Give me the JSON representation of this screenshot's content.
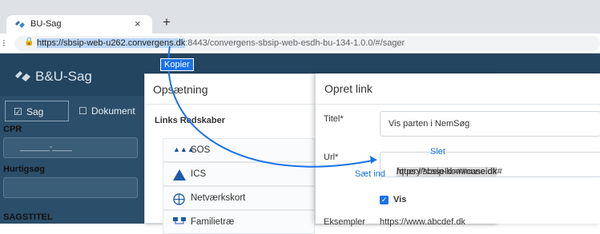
{
  "browser": {
    "tab_title": "BU-Sag",
    "tab_close": "×",
    "new_tab": "+",
    "url_selected": "https://sbsip-web-u262.convergens.dk",
    "url_rest": ":8443/convergens-sbsip-web-esdh-bu-134-1.0.0/#/sager"
  },
  "overlay": {
    "copy_label": "Kopier",
    "delete_label": "Slet",
    "insert_label": "Sæt ind",
    "accent": "#1a73e8"
  },
  "app": {
    "title": "B&U-Sag",
    "tabs": [
      {
        "label": "Sag"
      },
      {
        "label": "Dokument"
      }
    ],
    "fields": {
      "cpr_label": "CPR",
      "cpr_value": "______-____",
      "quick_label": "Hurtigsøg",
      "title_label": "SAGSTITEL"
    },
    "header_color": "#234560"
  },
  "setup_dialog": {
    "title": "Opsætning",
    "section": "Links Redskaber",
    "items": [
      {
        "label": "SOS",
        "icon": "sos-icon"
      },
      {
        "label": "ICS",
        "icon": "ics-icon"
      },
      {
        "label": "Netværkskort",
        "icon": "network-map-icon"
      },
      {
        "label": "Familietræ",
        "icon": "family-tree-icon"
      }
    ]
  },
  "link_dialog": {
    "title": "Opret link",
    "title_label": "Titel*",
    "title_value": "Vis parten i NemSøg",
    "url_label": "Url*",
    "url_selected": "https://sbsip-kommune.dk",
    "url_rest": "/query?caseId=##caseid##",
    "show_label": "Vis",
    "show_checked": true,
    "examples_label": "Eksempler",
    "examples_value": "https://www.abcdef.dk"
  }
}
